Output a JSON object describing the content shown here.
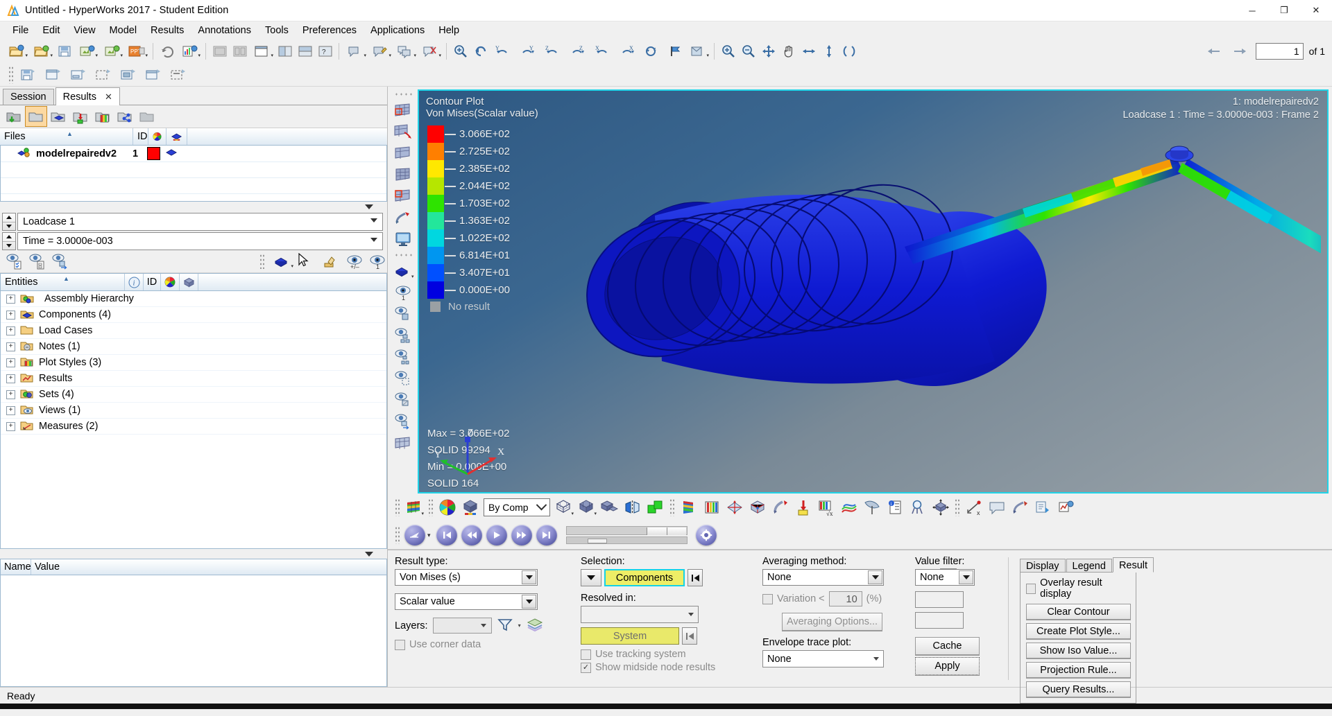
{
  "window": {
    "title": "Untitled - HyperWorks 2017 - Student Edition",
    "minimize": "─",
    "maximize": "❐",
    "close": "✕"
  },
  "menu": [
    "File",
    "Edit",
    "View",
    "Model",
    "Results",
    "Annotations",
    "Tools",
    "Preferences",
    "Applications",
    "Help"
  ],
  "pager": {
    "value": "1",
    "of_label": "of 1"
  },
  "left": {
    "tabs": [
      {
        "label": "Session",
        "active": false,
        "closable": false
      },
      {
        "label": "Results",
        "active": true,
        "closable": true
      }
    ],
    "files_header": {
      "name": "Files",
      "id": "ID"
    },
    "file_row": {
      "name": "modelrepairedv2",
      "id": "1"
    },
    "loadcase": "Loadcase 1",
    "time": "Time = 3.0000e-003",
    "entities_header": {
      "name": "Entities",
      "id": "ID"
    },
    "tree": [
      {
        "label": "Assembly Hierarchy",
        "icon": "assembly-icon"
      },
      {
        "label": "Components (4)",
        "icon": "components-icon"
      },
      {
        "label": "Load Cases",
        "icon": "folder-icon"
      },
      {
        "label": "Notes (1)",
        "icon": "notes-icon"
      },
      {
        "label": "Plot Styles (3)",
        "icon": "plotstyles-icon"
      },
      {
        "label": "Results",
        "icon": "results-icon"
      },
      {
        "label": "Sets  (4)",
        "icon": "sets-icon"
      },
      {
        "label": "Views (1)",
        "icon": "views-icon"
      },
      {
        "label": "Measures (2)",
        "icon": "measures-icon"
      }
    ],
    "namevalue_header": {
      "name": "Name",
      "value": "Value"
    }
  },
  "viewport": {
    "plot_title": "Contour Plot",
    "plot_subtitle": "Von Mises(Scalar value)",
    "model_label": "1: modelrepairedv2",
    "state_label": "Loadcase 1 : Time = 3.0000e-003 : Frame 2",
    "no_result_label": "No result",
    "max_label": "Max = 3.066E+02",
    "max_entity": "SOLID 99294",
    "min_label": "Min = 0.000E+00",
    "min_entity": "SOLID 164",
    "axis_x": "X",
    "axis_y": "Y",
    "axis_z": "Z"
  },
  "chart_data": {
    "type": "heatmap",
    "title": "Contour Plot",
    "subtitle": "Von Mises(Scalar value)",
    "legend_position": "left",
    "colorbar_labels": [
      "3.066E+02",
      "2.725E+02",
      "2.385E+02",
      "2.044E+02",
      "1.703E+02",
      "1.363E+02",
      "1.022E+02",
      "6.814E+01",
      "3.407E+01",
      "0.000E+00"
    ],
    "colorbar_values": [
      306.6,
      272.5,
      238.5,
      204.4,
      170.3,
      136.3,
      102.2,
      68.14,
      34.07,
      0.0
    ],
    "colorbar_colors": [
      "#ff0000",
      "#ff7f00",
      "#ffe800",
      "#b6e600",
      "#2ee300",
      "#23e69b",
      "#00d7e0",
      "#0096f0",
      "#0050ff",
      "#0000e0"
    ],
    "range": [
      0.0,
      306.6
    ],
    "units": "",
    "max": {
      "value": 306.6,
      "label": "Max = 3.066E+02",
      "entity": "SOLID 99294"
    },
    "min": {
      "value": 0.0,
      "label": "Min = 0.000E+00",
      "entity": "SOLID 164"
    },
    "no_result_label": "No result"
  },
  "anim_toolbar": {
    "by_comp": "By Comp"
  },
  "bottom": {
    "result_type_label": "Result type:",
    "result_type": "Von Mises (s)",
    "result_component": "Scalar value",
    "layers_label": "Layers:",
    "layers_value": "",
    "use_corner_data": "Use corner data",
    "dots_button": "...",
    "selection_label": "Selection:",
    "selection_button": "Components",
    "resolved_in_label": "Resolved in:",
    "resolved_in_value": "",
    "system_button": "System",
    "use_tracking_system": "Use tracking system",
    "show_midside_node_results": "Show midside node results",
    "averaging_label": "Averaging method:",
    "averaging_value": "None",
    "variation_label": "Variation <",
    "variation_value": "10",
    "variation_unit": "(%)",
    "averaging_options": "Averaging Options...",
    "envelope_label": "Envelope trace plot:",
    "envelope_value": "None",
    "value_filter_label": "Value filter:",
    "value_filter_value": "None",
    "filter_min": "",
    "filter_max": "",
    "cache_button": "Cache",
    "apply_button": "Apply",
    "tabs": [
      {
        "label": "Display",
        "active": false
      },
      {
        "label": "Legend",
        "active": false
      },
      {
        "label": "Result",
        "active": true
      }
    ],
    "overlay_result_display": "Overlay result display",
    "buttons": [
      "Clear Contour",
      "Create Plot Style...",
      "Show Iso Value...",
      "Projection Rule...",
      "Query Results..."
    ]
  },
  "status": {
    "text": "Ready"
  },
  "colors": {
    "viewport_border": "#21d4e8",
    "selection_yellow": "#efef5f",
    "panel_bg": "#f0f0f0",
    "model_blue": "#0b19d8"
  }
}
